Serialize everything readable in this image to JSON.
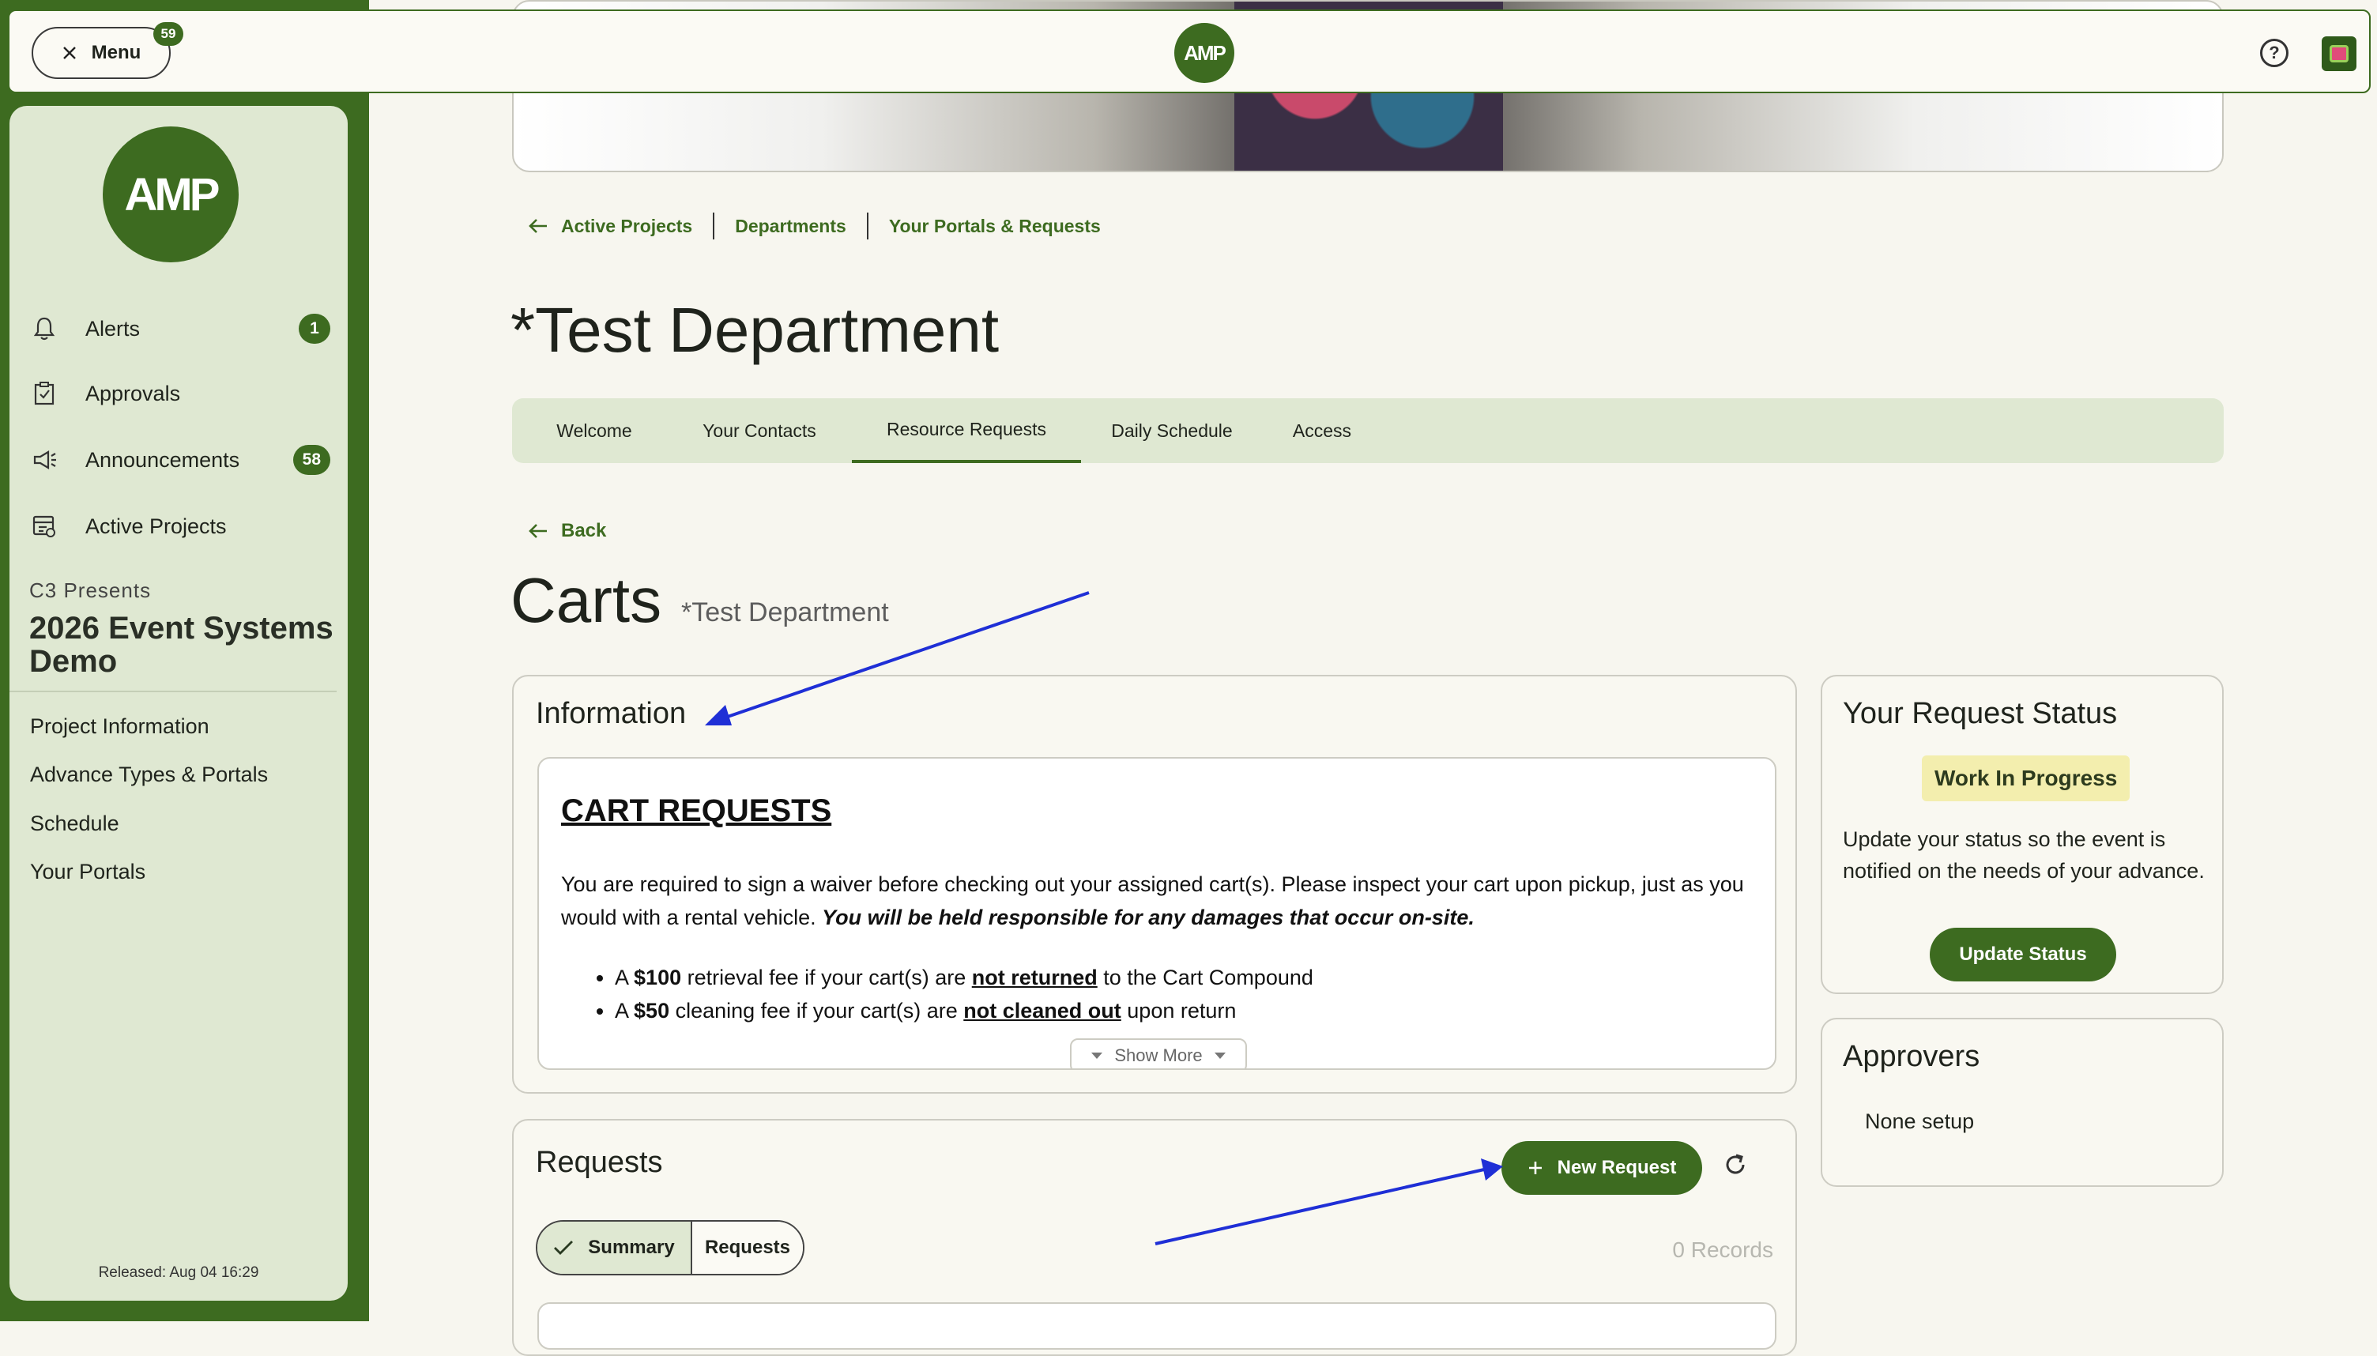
{
  "topbar": {
    "menu_label": "Menu",
    "menu_badge": "59",
    "logo_text": "AMP"
  },
  "sidebar": {
    "logo_text": "AMP",
    "nav": [
      {
        "label": "Alerts",
        "badge": "1",
        "icon": "bell-icon"
      },
      {
        "label": "Approvals",
        "badge": "",
        "icon": "clipboard-check-icon"
      },
      {
        "label": "Announcements",
        "badge": "58",
        "icon": "megaphone-icon"
      },
      {
        "label": "Active Projects",
        "badge": "",
        "icon": "projects-icon"
      }
    ],
    "project_presents": "C3 Presents",
    "project_title": "2026 Event Systems Demo",
    "links": [
      "Project Information",
      "Advance Types & Portals",
      "Schedule",
      "Your Portals"
    ],
    "released": "Released: Aug 04 16:29"
  },
  "breadcrumbs": [
    "Active Projects",
    "Departments",
    "Your Portals & Requests"
  ],
  "department_title": "*Test Department",
  "tabs": [
    "Welcome",
    "Your Contacts",
    "Resource Requests",
    "Daily Schedule",
    "Access"
  ],
  "active_tab": "Resource Requests",
  "back_label": "Back",
  "page_title": "Carts",
  "page_subtitle": "*Test Department",
  "information": {
    "title": "Information",
    "heading": "CART REQUESTS",
    "para_plain": "You are required to sign a waiver before checking out your assigned cart(s). Please inspect your cart upon pickup, just as you would with a rental vehicle. ",
    "para_emph": "You will be held responsible for any damages that occur on-site.",
    "bullet1": {
      "a": "A ",
      "b": "$100",
      "c": " retrieval fee if your cart(s) are ",
      "d": "not returned",
      "e": " to the Cart Compound"
    },
    "bullet2": {
      "a": "A ",
      "b": "$50",
      "c": " cleaning fee if your cart(s) are ",
      "d": "not cleaned out",
      "e": " upon return"
    },
    "show_more": "Show More"
  },
  "request_status": {
    "title": "Your Request Status",
    "badge": "Work In Progress",
    "text": "Update your status so the event is notified on the needs of your advance.",
    "button": "Update Status"
  },
  "approvers": {
    "title": "Approvers",
    "value": "None setup"
  },
  "requests": {
    "title": "Requests",
    "new_button": "New Request",
    "seg_summary": "Summary",
    "seg_requests": "Requests",
    "records": "0 Records"
  },
  "colors": {
    "brand": "#3d6b20",
    "panel": "#dfe8d2",
    "annotation": "#1f2fd6",
    "badge_bg": "#f3eeae"
  }
}
